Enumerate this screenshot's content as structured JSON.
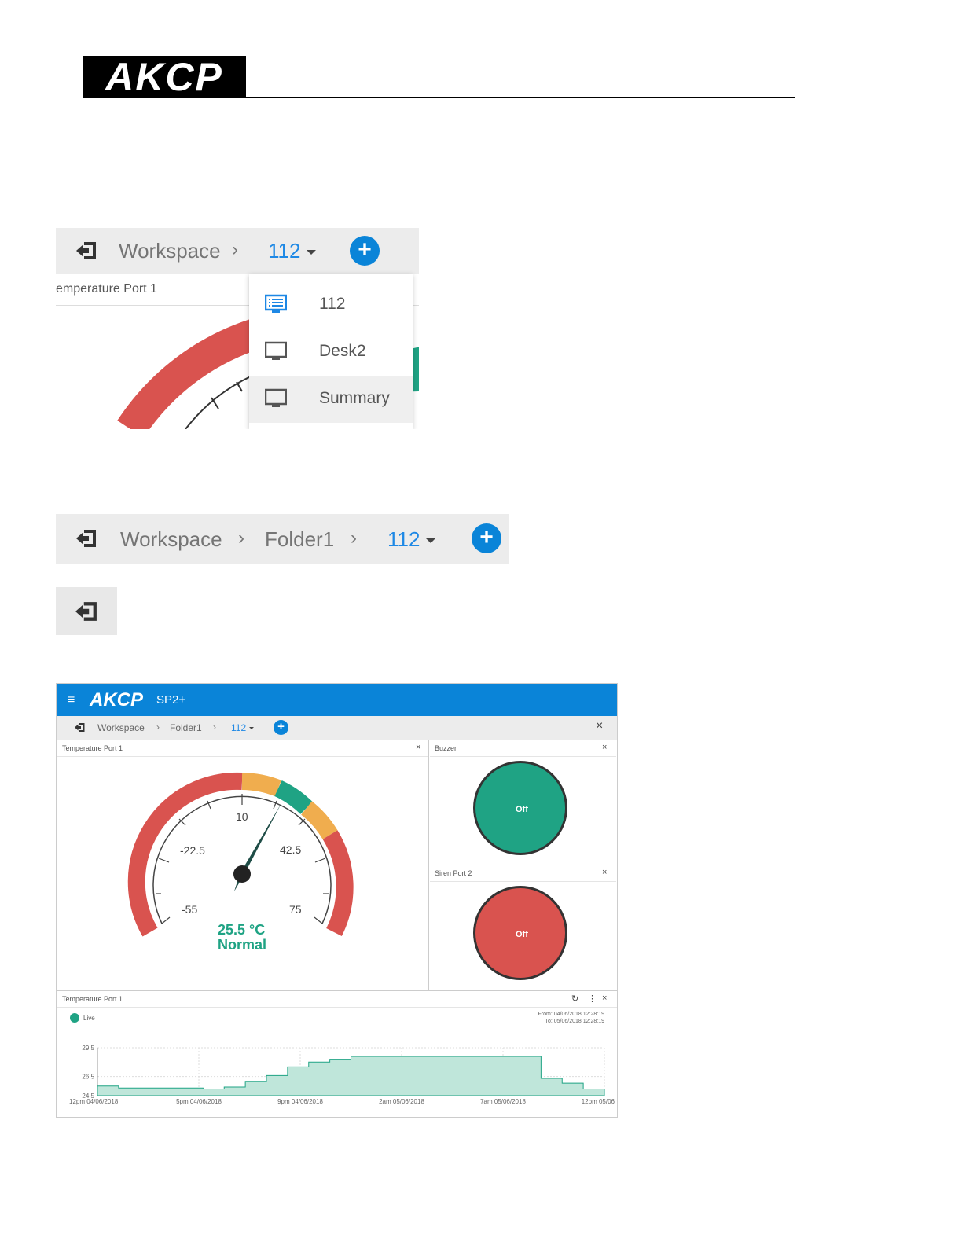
{
  "logo": {
    "text": "AKCP"
  },
  "screen1": {
    "breadcrumb": {
      "workspace": "Workspace",
      "current": "112"
    },
    "panel_title": "emperature Port 1",
    "dropdown": {
      "items": [
        {
          "label": "112",
          "icon": "dashboard-list-icon",
          "active": true
        },
        {
          "label": "Desk2",
          "icon": "monitor-icon"
        },
        {
          "label": "Summary",
          "icon": "monitor-icon",
          "hovered": true
        }
      ]
    }
  },
  "screen2": {
    "breadcrumb": {
      "workspace": "Workspace",
      "folder": "Folder1",
      "current": "112"
    }
  },
  "dashboard": {
    "app": {
      "logo": "AKCP",
      "product": "SP2+"
    },
    "breadcrumb": {
      "workspace": "Workspace",
      "folder": "Folder1",
      "current": "112"
    },
    "temperature_panel": {
      "title": "Temperature Port 1",
      "gauge": {
        "ticks": [
          "-55",
          "-22.5",
          "10",
          "42.5",
          "75"
        ],
        "reading": "25.5 °C",
        "status": "Normal",
        "value": 25.5,
        "min": -55,
        "max": 75
      }
    },
    "buzzer_panel": {
      "title": "Buzzer",
      "state": "Off",
      "color": "#1fa384"
    },
    "siren_panel": {
      "title": "Siren Port 2",
      "state": "Off",
      "color": "#d9534f"
    },
    "history_panel": {
      "title": "Temperature Port 1",
      "legend": "Live",
      "from": "From: 04/06/2018 12:28:19",
      "to": "To: 05/06/2018 12:28:19"
    }
  },
  "colors": {
    "accent": "#0a84d8",
    "ok_green": "#1fa384",
    "alarm_red": "#d9534f",
    "warn_orange": "#f0ad4e"
  },
  "chart_data": {
    "type": "area",
    "x_tick_labels": [
      "12pm 04/06/2018",
      "5pm 04/06/2018",
      "9pm 04/06/2018",
      "2am 05/06/2018",
      "7am 05/06/2018",
      "12pm 05/06"
    ],
    "y_tick_labels": [
      "29.5",
      "26.5",
      "24.5"
    ],
    "ylim": [
      24.5,
      29.5
    ],
    "series": [
      {
        "name": "Live",
        "color": "#1fa384",
        "x_hours": [
          0,
          1,
          2,
          3,
          4,
          5,
          6,
          7,
          8,
          9,
          10,
          11,
          12,
          13,
          14,
          15,
          16,
          17,
          18,
          19,
          20,
          21,
          22,
          23,
          24
        ],
        "values": [
          25.5,
          25.3,
          25.3,
          25.3,
          25.3,
          25.2,
          25.4,
          26.0,
          26.6,
          27.5,
          28.0,
          28.3,
          28.6,
          28.6,
          28.6,
          28.6,
          28.6,
          28.6,
          28.6,
          28.6,
          28.6,
          26.3,
          25.8,
          25.2,
          25.1
        ]
      }
    ]
  }
}
